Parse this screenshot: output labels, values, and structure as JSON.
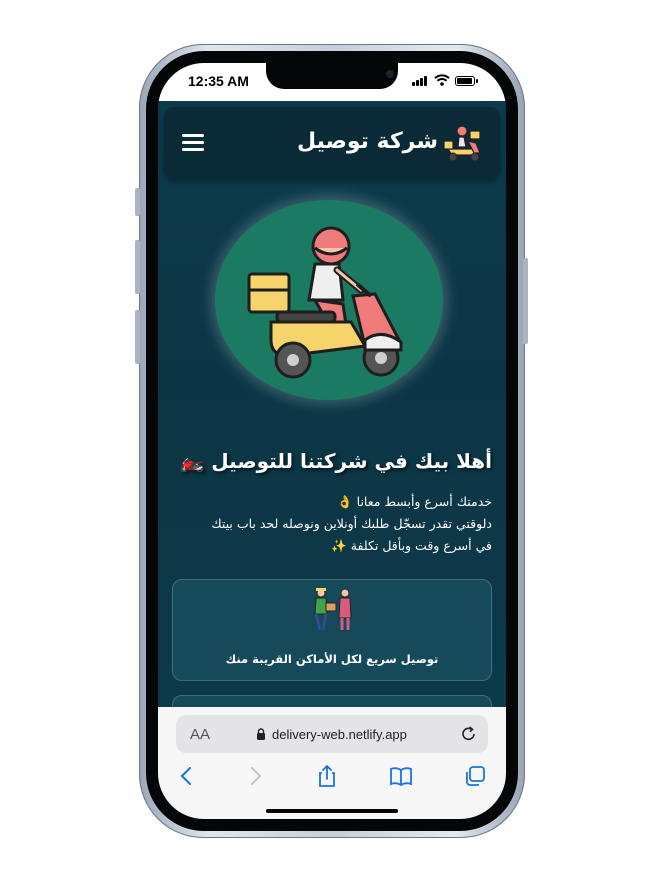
{
  "status_bar": {
    "time": "12:35 AM"
  },
  "header": {
    "title": "شركة توصيل",
    "menu_icon": "hamburger-menu-icon",
    "logo_icon": "delivery-scooter-icon"
  },
  "hero": {
    "image_icon": "delivery-scooter-illustration"
  },
  "intro": {
    "heading": "أهلا بيك في شركتنا للتوصيل 🏍️",
    "lines": [
      "خدمتك أسرع وأبسط معانا 👌",
      "دلوقتي تقدر تسجّل طلبك أونلاين ونوصله لحد باب بيتك",
      "في أسرع وقت وبأقل تكلفة ✨"
    ]
  },
  "features": [
    {
      "title": "توصيل سريع لكل الأماكن القريبة منك",
      "icon": "courier-handing-package-icon"
    }
  ],
  "browser": {
    "text_size_label": "AA",
    "url": "delivery-web.netlify.app"
  },
  "colors": {
    "page_bg": "#0b3544",
    "navbar_bg": "#0a2a38",
    "hero_circle": "#1b7a62",
    "card_bg": "#164a5a",
    "safari_blue": "#1a73e8"
  }
}
